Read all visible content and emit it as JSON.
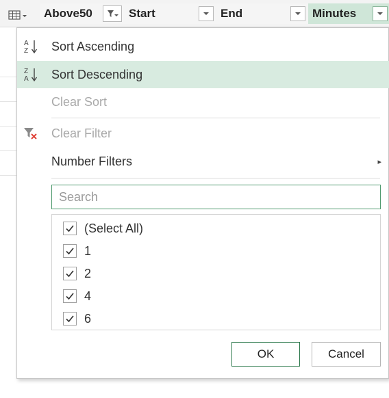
{
  "header": {
    "columns": [
      {
        "label": "Above50"
      },
      {
        "label": "Start"
      },
      {
        "label": "End"
      },
      {
        "label": "Minutes"
      }
    ]
  },
  "menu": {
    "sort_ascending": "Sort Ascending",
    "sort_descending": "Sort Descending",
    "clear_sort": "Clear Sort",
    "clear_filter": "Clear Filter",
    "number_filters": "Number Filters",
    "submenu_arrow": "▸"
  },
  "search": {
    "placeholder": "Search",
    "value": ""
  },
  "checklist": [
    {
      "label": "(Select All)",
      "checked": true
    },
    {
      "label": "1",
      "checked": true
    },
    {
      "label": "2",
      "checked": true
    },
    {
      "label": "4",
      "checked": true
    },
    {
      "label": "6",
      "checked": true
    }
  ],
  "buttons": {
    "ok": "OK",
    "cancel": "Cancel"
  },
  "colors": {
    "active_column": "#cfe6d8",
    "hover_item": "#d8ebe0",
    "focus_border": "#4f9a6e",
    "clear_filter_x": "#e0443a"
  },
  "icons": {
    "table": "table-menu-icon",
    "filter": "filter-icon",
    "dropdown": "chevron-down-icon",
    "sort_ascending": "sort-ascending-icon",
    "sort_descending": "sort-descending-icon",
    "clear_filter": "clear-filter-icon",
    "check": "checkmark-icon"
  }
}
